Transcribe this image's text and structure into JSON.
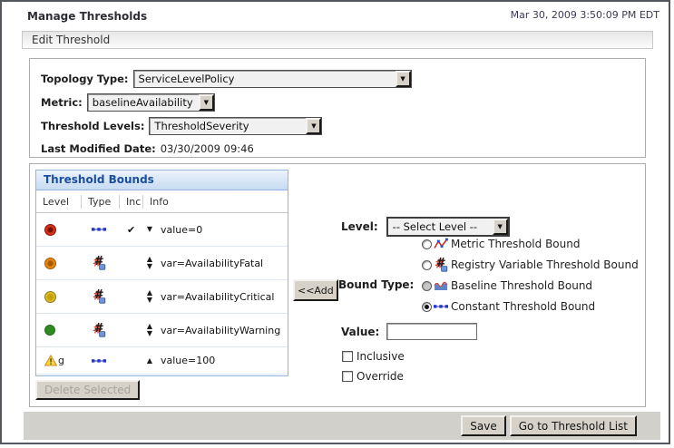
{
  "header": {
    "title": "Manage Thresholds",
    "timestamp": "Mar 30, 2009 3:50:09 PM EDT"
  },
  "tab": {
    "title": "Edit Threshold"
  },
  "form": {
    "topology_type_label": "Topology Type:",
    "topology_type_value": "ServiceLevelPolicy",
    "metric_label": "Metric:",
    "metric_value": "baselineAvailability",
    "threshold_levels_label": "Threshold Levels:",
    "threshold_levels_value": "ThresholdSeverity",
    "last_modified_label": "Last Modified Date:",
    "last_modified_value": "03/30/2009 09:46"
  },
  "bounds_panel": {
    "title": "Threshold Bounds",
    "columns": [
      "Level",
      "Type",
      "Inc",
      "Info"
    ],
    "rows": [
      {
        "level_icon": "severity-fatal-circle",
        "type_icon": "constant-threshold-icon",
        "inclusive_mark": "✔",
        "direction": "down",
        "info": "value=0"
      },
      {
        "level_icon": "severity-critical-circle",
        "type_icon": "registry-variable-icon",
        "inclusive_mark": "",
        "direction": "up-down",
        "info": "var=AvailabilityFatal"
      },
      {
        "level_icon": "severity-warning-circle",
        "type_icon": "registry-variable-icon",
        "inclusive_mark": "",
        "direction": "up-down",
        "info": "var=AvailabilityCritical"
      },
      {
        "level_icon": "severity-normal-circle",
        "type_icon": "registry-variable-icon",
        "inclusive_mark": "",
        "direction": "up-down",
        "info": "var=AvailabilityWarning"
      },
      {
        "level_icon": "warning-triangle-icon",
        "level_text": "g",
        "type_icon": "constant-threshold-icon",
        "inclusive_mark": "",
        "direction": "up",
        "info": "value=100"
      }
    ],
    "delete_button": "Delete Selected"
  },
  "add_button": "<<Add",
  "editor": {
    "level_label": "Level:",
    "level_value": "-- Select Level --",
    "bound_type_label": "Bound Type:",
    "bound_types": [
      {
        "label": "Metric Threshold Bound",
        "icon": "metric-threshold-icon",
        "selected": false
      },
      {
        "label": "Registry Variable Threshold Bound",
        "icon": "registry-variable-icon",
        "selected": false
      },
      {
        "label": "Baseline Threshold Bound",
        "icon": "baseline-threshold-icon",
        "selected": false
      },
      {
        "label": "Constant Threshold Bound",
        "icon": "constant-threshold-icon",
        "selected": true
      }
    ],
    "value_label": "Value:",
    "value": "",
    "inclusive_label": "Inclusive",
    "inclusive_checked": false,
    "override_label": "Override",
    "override_checked": false
  },
  "footer": {
    "save_button": "Save",
    "goto_button": "Go to Threshold List"
  },
  "glyphs": {
    "sort_up": "▲",
    "sort_down": "▼",
    "dropdown_arrow": "▼"
  },
  "colors": {
    "panel_header_text": "#1a4e9e",
    "panel_border": "#94b5dd",
    "severity_fatal": "#c3250e",
    "severity_critical": "#e08112",
    "severity_warning": "#d8ba1d",
    "severity_normal": "#2f8b22",
    "bound_accent_blue": "#2436c7"
  }
}
